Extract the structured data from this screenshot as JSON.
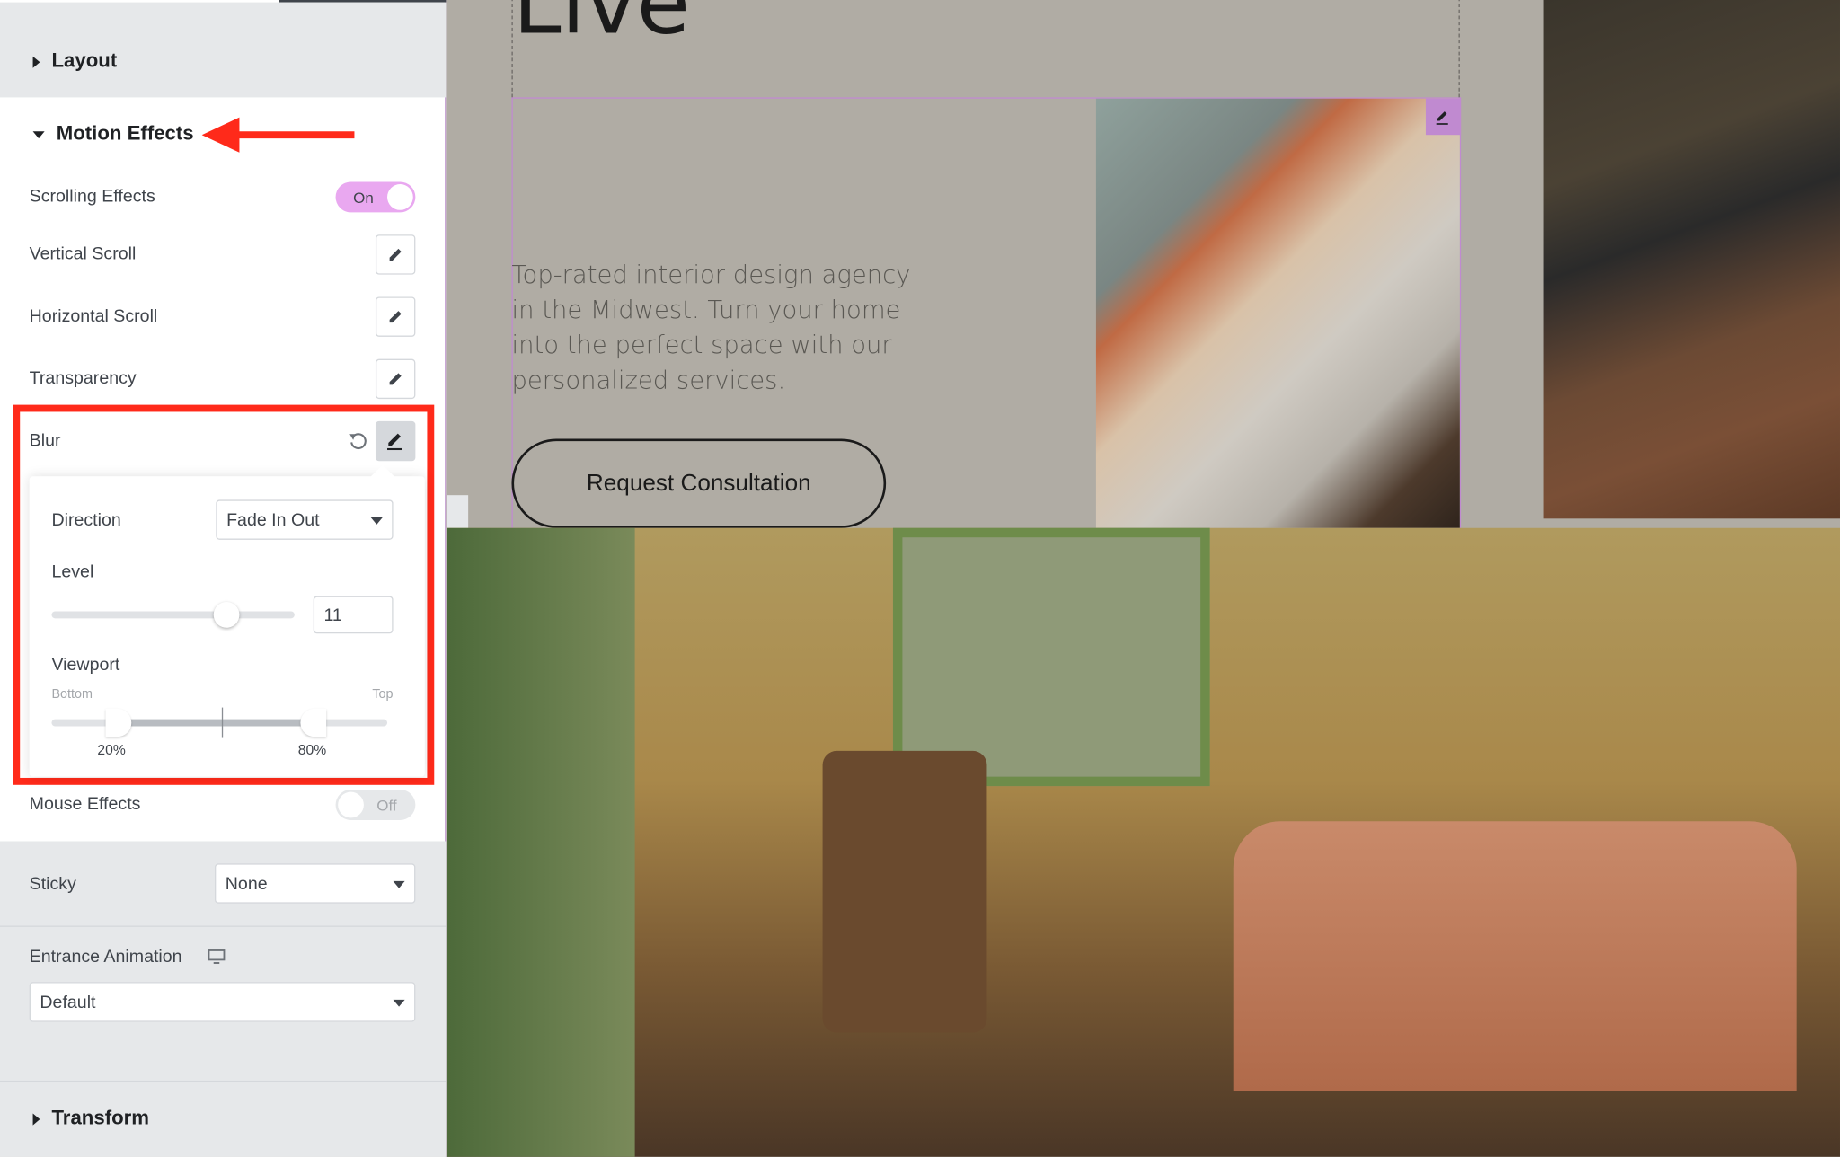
{
  "panel": {
    "layout_label": "Layout",
    "motion_effects_label": "Motion Effects",
    "scrolling_effects": {
      "label": "Scrolling Effects",
      "toggle": "On",
      "enabled": true
    },
    "vertical_scroll": "Vertical Scroll",
    "horizontal_scroll": "Horizontal Scroll",
    "transparency": "Transparency",
    "blur": {
      "label": "Blur",
      "direction_label": "Direction",
      "direction_value": "Fade In Out",
      "level_label": "Level",
      "level_value": "11",
      "level_fraction": 0.72,
      "viewport_label": "Viewport",
      "viewport_bottom": "Bottom",
      "viewport_top": "Top",
      "viewport_start": "20%",
      "viewport_end": "80%"
    },
    "mouse_effects": {
      "label": "Mouse Effects",
      "toggle": "Off",
      "enabled": false
    },
    "sticky": {
      "label": "Sticky",
      "value": "None"
    },
    "entrance_animation": {
      "label": "Entrance Animation",
      "value": "Default"
    },
    "transform_label": "Transform"
  },
  "canvas": {
    "heading_fragment": "Live",
    "description": "Top-rated interior design agency in the Midwest. Turn your home into the perfect space with our personalized services.",
    "cta": "Request Consultation"
  },
  "colors": {
    "accent": "#ff2a1a",
    "toggle_on": "#e9a8f0",
    "editor_outline": "#c08ad0"
  }
}
